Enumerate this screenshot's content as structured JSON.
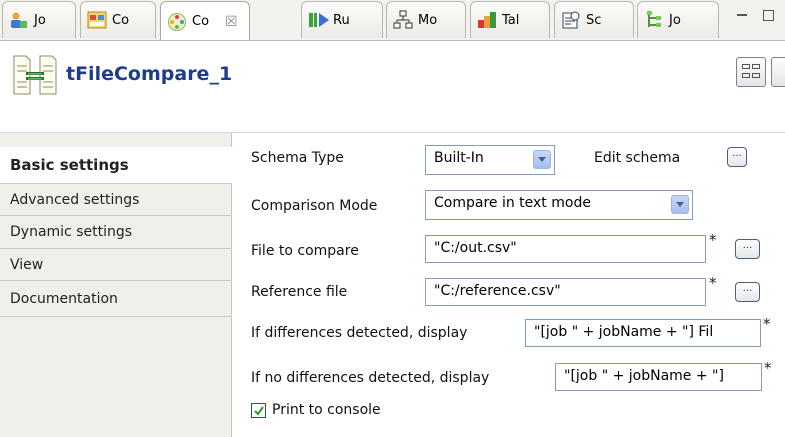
{
  "tabs": [
    {
      "label": "Jo",
      "icon": "job-icon"
    },
    {
      "label": "Co",
      "icon": "contexts-icon"
    },
    {
      "label": "Co",
      "icon": "component-icon",
      "close": "☒"
    },
    {
      "label": "Ru",
      "icon": "run-icon"
    },
    {
      "label": "Mo",
      "icon": "modules-icon"
    },
    {
      "label": "Tal",
      "icon": "talend-exchange-icon"
    },
    {
      "label": "Sc",
      "icon": "scheduler-icon"
    },
    {
      "label": "Jo",
      "icon": "job-hierarchy-icon"
    }
  ],
  "header": {
    "title": "tFileCompare_1"
  },
  "nav": {
    "items": [
      {
        "label": "Basic settings"
      },
      {
        "label": "Advanced settings"
      },
      {
        "label": "Dynamic settings"
      },
      {
        "label": "View"
      },
      {
        "label": "Documentation"
      }
    ]
  },
  "form": {
    "schema_type_label": "Schema Type",
    "schema_type_value": "Built-In",
    "edit_schema_label": "Edit schema",
    "comparison_mode_label": "Comparison Mode",
    "comparison_mode_value": "Compare in text mode",
    "file_to_compare_label": "File to compare",
    "file_to_compare_value": "\"C:/out.csv\"",
    "reference_file_label": "Reference file",
    "reference_file_value": "\"C:/reference.csv\"",
    "diff_label": "If differences detected, display",
    "diff_value": "\"[job \" + jobName + \"] Fil",
    "nodiff_label": "If no differences detected, display",
    "nodiff_value": "\"[job \" + jobName + \"]",
    "print_console_label": "Print to console",
    "print_console_checked": true,
    "required_mark": "*",
    "browse_label": "..."
  },
  "colors": {
    "title": "#1d3d8c",
    "field_border": "#7f9db9",
    "nav_bg": "#f0efea"
  }
}
